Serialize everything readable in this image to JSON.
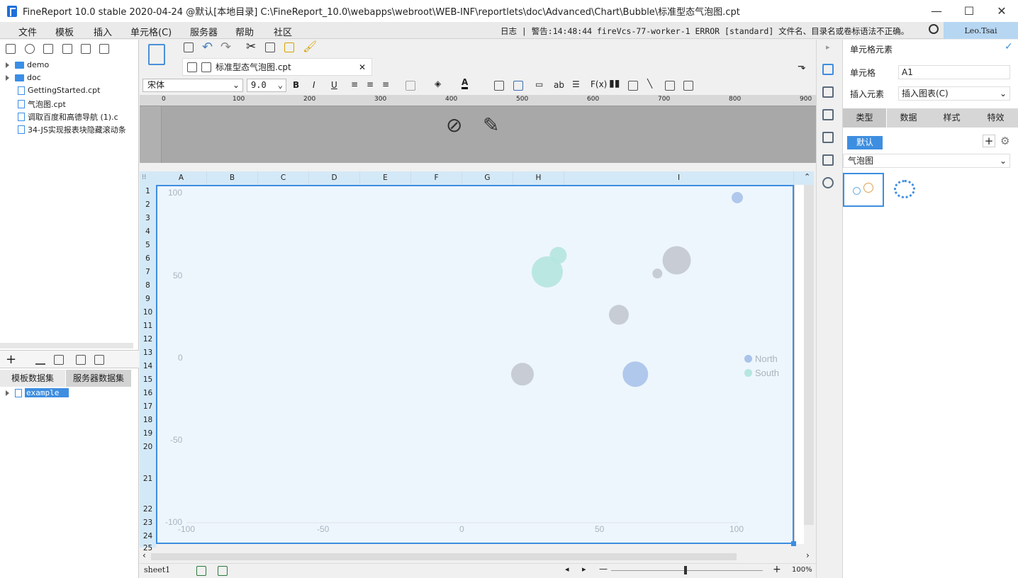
{
  "window": {
    "title": "FineReport 10.0 stable 2020-04-24 @默认[本地目录]    C:\\FineReport_10.0\\webapps\\webroot\\WEB-INF\\reportlets\\doc\\Advanced\\Chart\\Bubble\\标准型态气泡图.cpt",
    "min": "—",
    "max": "☐",
    "close": "✕"
  },
  "menu": [
    "文件",
    "模板",
    "插入",
    "单元格(C)",
    "服务器",
    "帮助",
    "社区"
  ],
  "log": "日志 | 警告:14:48:44 fireVcs-77-worker-1 ERROR [standard] 文件名、目录名或卷标语法不正确。",
  "user": "Leo.Tsai",
  "tree": [
    {
      "label": "demo",
      "type": "folder"
    },
    {
      "label": "doc",
      "type": "folder"
    },
    {
      "label": "GettingStarted.cpt",
      "type": "file"
    },
    {
      "label": "气泡图.cpt",
      "type": "file"
    },
    {
      "label": "调取百度和高德导航 (1).c",
      "type": "file"
    },
    {
      "label": "34-JS实现报表块隐藏滚动条",
      "type": "file"
    }
  ],
  "dataset_tabs": [
    "模板数据集",
    "服务器数据集"
  ],
  "dataset_item": "example",
  "doc_tab": "标准型态气泡图.cpt",
  "font": {
    "name": "宋体",
    "size": "9.0"
  },
  "ruler": [
    "0",
    "100",
    "200",
    "300",
    "400",
    "500",
    "600",
    "700",
    "800",
    "900"
  ],
  "columns": [
    "A",
    "B",
    "C",
    "D",
    "E",
    "F",
    "G",
    "H",
    "I"
  ],
  "rows": [
    "1",
    "2",
    "3",
    "4",
    "5",
    "6",
    "7",
    "8",
    "9",
    "10",
    "11",
    "12",
    "13",
    "14",
    "15",
    "16",
    "17",
    "18",
    "19",
    "20",
    "21",
    "22",
    "23",
    "24",
    "25"
  ],
  "sheet": "sheet1",
  "zoom": "100%",
  "right": {
    "header": "单元格元素",
    "cell_label": "单元格",
    "cell_value": "A1",
    "insert_label": "插入元素",
    "insert_value": "插入图表(C)",
    "tabs": [
      "类型",
      "数据",
      "样式",
      "特效"
    ],
    "default_btn": "默认",
    "chart_type": "气泡图"
  },
  "chart_data": {
    "type": "scatter",
    "xlim": [
      -100,
      100
    ],
    "ylim": [
      -100,
      100
    ],
    "xticks": [
      "-100",
      "-50",
      "0",
      "50",
      "100"
    ],
    "yticks": [
      "100",
      "50",
      "0",
      "-50",
      "-100"
    ],
    "legend": [
      "North",
      "South"
    ],
    "colors": {
      "North": "#a9c3ea",
      "South": "#b5e6df",
      "gray": "#c3c9d0"
    },
    "series": [
      {
        "name": "North",
        "points": [
          [
            100,
            97,
            8
          ],
          [
            63,
            -10,
            18
          ]
        ]
      },
      {
        "name": "South",
        "points": [
          [
            31,
            52,
            22
          ],
          [
            35,
            62,
            12
          ]
        ]
      },
      {
        "name": "",
        "points": [
          [
            78,
            59,
            20
          ],
          [
            71,
            51,
            7
          ],
          [
            57,
            26,
            14
          ],
          [
            22,
            -10,
            16
          ]
        ]
      }
    ]
  }
}
